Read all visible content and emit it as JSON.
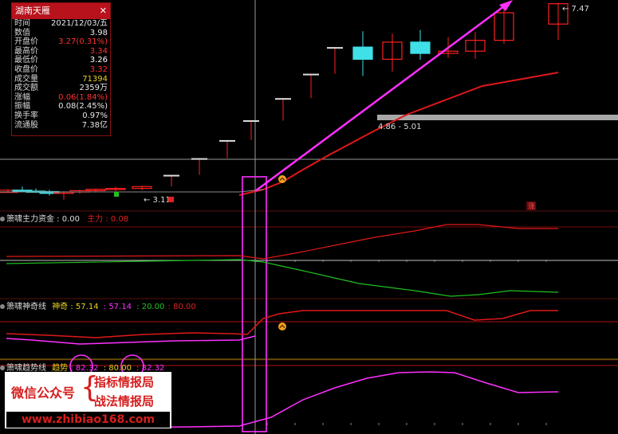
{
  "info_panel": {
    "title": "湖南天雁",
    "close": "✕",
    "rows": [
      {
        "k": "时间",
        "v": "2021/12/03/五",
        "color": "#e8e8e8"
      },
      {
        "k": "数值",
        "v": "3.98",
        "color": "#e8e8e8"
      },
      {
        "k": "开盘价",
        "v": "3.27(0.31%)",
        "color": "#ff3030"
      },
      {
        "k": "最高价",
        "v": "3.34",
        "color": "#ff3030"
      },
      {
        "k": "最低价",
        "v": "3.26",
        "color": "#ffffff"
      },
      {
        "k": "收盘价",
        "v": "3.32",
        "color": "#ff3030"
      },
      {
        "k": "成交量",
        "v": "71394",
        "color": "#e8d020"
      },
      {
        "k": "成交额",
        "v": "2359万",
        "color": "#e8e8e8"
      },
      {
        "k": "涨幅",
        "v": "0.06(1.84%)",
        "color": "#ff3030"
      },
      {
        "k": "振幅",
        "v": "0.08(2.45%)",
        "color": "#e8e8e8"
      },
      {
        "k": "换手率",
        "v": "0.97%",
        "color": "#e8e8e8"
      },
      {
        "k": "流通股",
        "v": "7.38亿",
        "color": "#e8e8e8"
      }
    ]
  },
  "price_labels": {
    "high": "7.47",
    "range": "4.86 - 5.01",
    "low": "3.11",
    "rise_tag": "涨"
  },
  "indicators": {
    "ind1": {
      "name": "箫啸主力资金",
      "v1_label": "0.00",
      "v2_label": "主力",
      "v2": "0.08"
    },
    "ind2": {
      "name": "箫啸神奇线",
      "s1_label": "神奇",
      "s1": "57.14",
      "s2": "57.14",
      "s3": "20.00",
      "s4": "80.00"
    },
    "ind3": {
      "name": "箫啸趋势线",
      "s1_label": "趋势",
      "s1": "82.32",
      "s2": "80.00",
      "s3": "82.32"
    }
  },
  "overlay": {
    "left": "微信公众号",
    "brace": "{",
    "right1": "指标情报局",
    "right2": "战法情报局",
    "url": "www.zhibiao168.com"
  },
  "colors": {
    "up": "#ff2020",
    "down": "#40e0e8",
    "ma": "#e01818",
    "trend": "#ff30ff",
    "green": "#20c020",
    "gray": "#a0a0a0"
  },
  "chart_data": {
    "type": "candlestick",
    "candles": [
      {
        "o": 3.27,
        "h": 3.34,
        "l": 3.26,
        "c": 3.32
      },
      {
        "o": 3.32,
        "h": 3.4,
        "l": 3.28,
        "c": 3.3
      },
      {
        "o": 3.3,
        "h": 3.36,
        "l": 3.26,
        "c": 3.29
      },
      {
        "o": 3.29,
        "h": 3.33,
        "l": 3.2,
        "c": 3.25
      },
      {
        "o": 3.25,
        "h": 3.3,
        "l": 3.11,
        "c": 3.28
      },
      {
        "o": 3.28,
        "h": 3.33,
        "l": 3.24,
        "c": 3.31
      },
      {
        "o": 3.31,
        "h": 3.36,
        "l": 3.27,
        "c": 3.34
      },
      {
        "o": 3.34,
        "h": 3.4,
        "l": 3.3,
        "c": 3.36
      },
      {
        "o": 3.36,
        "h": 3.42,
        "l": 3.32,
        "c": 3.4
      },
      {
        "o": 3.4,
        "h": 3.66,
        "l": 3.4,
        "c": 3.66
      },
      {
        "o": 3.66,
        "h": 4.03,
        "l": 3.66,
        "c": 4.03
      },
      {
        "o": 4.03,
        "h": 4.43,
        "l": 4.03,
        "c": 4.43
      },
      {
        "o": 4.43,
        "h": 4.87,
        "l": 4.43,
        "c": 4.87
      },
      {
        "o": 4.86,
        "h": 5.36,
        "l": 4.86,
        "c": 5.36
      },
      {
        "o": 5.36,
        "h": 5.9,
        "l": 5.36,
        "c": 5.9
      },
      {
        "o": 5.9,
        "h": 6.49,
        "l": 5.9,
        "c": 6.49
      },
      {
        "o": 6.49,
        "h": 6.84,
        "l": 5.85,
        "c": 6.22
      },
      {
        "o": 6.22,
        "h": 6.79,
        "l": 5.95,
        "c": 6.6
      },
      {
        "o": 6.6,
        "h": 6.87,
        "l": 6.21,
        "c": 6.35
      },
      {
        "o": 6.35,
        "h": 6.71,
        "l": 6.25,
        "c": 6.4
      },
      {
        "o": 6.4,
        "h": 6.82,
        "l": 6.23,
        "c": 6.64
      },
      {
        "o": 6.64,
        "h": 7.38,
        "l": 6.56,
        "c": 7.25
      },
      {
        "o": 7.0,
        "h": 7.47,
        "l": 6.65,
        "c": 7.45
      }
    ]
  }
}
